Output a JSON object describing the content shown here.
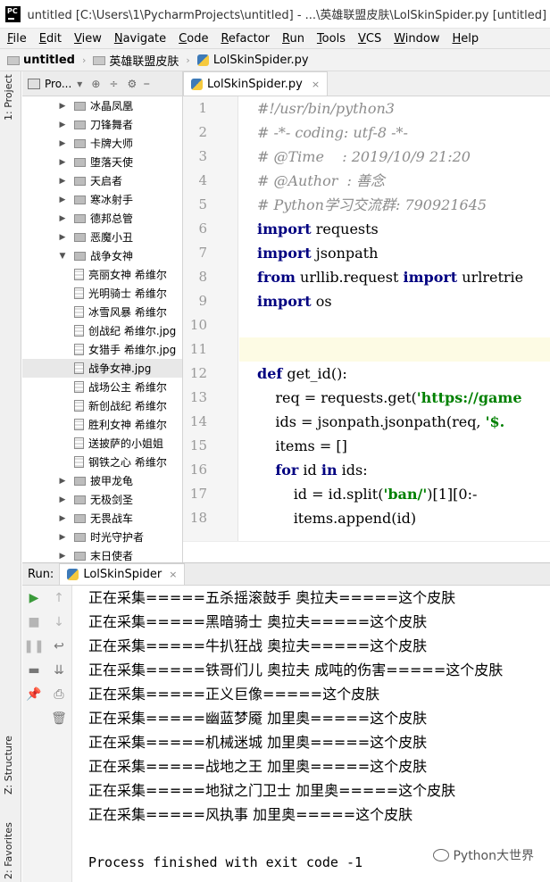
{
  "window": {
    "title": "untitled [C:\\Users\\1\\PycharmProjects\\untitled] - ...\\英雄联盟皮肤\\LolSkinSpider.py [untitled] - PyCharm",
    "logo_text": "PC"
  },
  "menu": [
    "File",
    "Edit",
    "View",
    "Navigate",
    "Code",
    "Refactor",
    "Run",
    "Tools",
    "VCS",
    "Window",
    "Help"
  ],
  "breadcrumb": {
    "project": "untitled",
    "folder": "英雄联盟皮肤",
    "file": "LolSkinSpider.py"
  },
  "project_panel": {
    "title": "Pro...",
    "side_tab": "1: Project",
    "items": [
      {
        "label": "冰晶凤凰",
        "type": "folder",
        "state": "collapsed"
      },
      {
        "label": "刀锋舞者",
        "type": "folder",
        "state": "collapsed"
      },
      {
        "label": "卡牌大师",
        "type": "folder",
        "state": "collapsed"
      },
      {
        "label": "堕落天使",
        "type": "folder",
        "state": "collapsed"
      },
      {
        "label": "天启者",
        "type": "folder",
        "state": "collapsed"
      },
      {
        "label": "寒冰射手",
        "type": "folder",
        "state": "collapsed"
      },
      {
        "label": "德邦总管",
        "type": "folder",
        "state": "collapsed"
      },
      {
        "label": "恶魔小丑",
        "type": "folder",
        "state": "collapsed"
      },
      {
        "label": "战争女神",
        "type": "folder",
        "state": "expanded"
      },
      {
        "label": "亮丽女神 希维尔",
        "type": "file"
      },
      {
        "label": "光明骑士 希维尔",
        "type": "file"
      },
      {
        "label": "冰雪风暴 希维尔",
        "type": "file"
      },
      {
        "label": "创战纪 希维尔.jpg",
        "type": "file"
      },
      {
        "label": "女猎手 希维尔.jpg",
        "type": "file"
      },
      {
        "label": "战争女神.jpg",
        "type": "file",
        "selected": true
      },
      {
        "label": "战场公主 希维尔",
        "type": "file"
      },
      {
        "label": "新创战纪 希维尔",
        "type": "file"
      },
      {
        "label": "胜利女神 希维尔",
        "type": "file"
      },
      {
        "label": "送披萨的小姐姐",
        "type": "file"
      },
      {
        "label": "钢铁之心 希维尔",
        "type": "file"
      },
      {
        "label": "披甲龙龟",
        "type": "folder",
        "state": "collapsed"
      },
      {
        "label": "无极剑圣",
        "type": "folder",
        "state": "collapsed"
      },
      {
        "label": "无畏战车",
        "type": "folder",
        "state": "collapsed"
      },
      {
        "label": "时光守护者",
        "type": "folder",
        "state": "collapsed"
      },
      {
        "label": "末日使者",
        "type": "folder",
        "state": "collapsed"
      }
    ]
  },
  "editor": {
    "tab": "LolSkinSpider.py",
    "line_numbers": [
      "1",
      "2",
      "3",
      "4",
      "5",
      "6",
      "7",
      "8",
      "9",
      "10",
      "11",
      "12",
      "13",
      "14",
      "15",
      "16",
      "17",
      "18"
    ],
    "lines": [
      [
        {
          "t": "#!/usr/bin/python3",
          "c": "cm"
        }
      ],
      [
        {
          "t": "# -*- coding: utf-8 -*-",
          "c": "cm"
        }
      ],
      [
        {
          "t": "# @Time    : 2019/10/9 21:20",
          "c": "cm"
        }
      ],
      [
        {
          "t": "# @Author  : 善念",
          "c": "cm"
        }
      ],
      [
        {
          "t": "# Python学习交流群: 790921645",
          "c": "cm"
        }
      ],
      [
        {
          "t": "import",
          "c": "kw"
        },
        {
          "t": " requests",
          "c": ""
        }
      ],
      [
        {
          "t": "import",
          "c": "kw"
        },
        {
          "t": " jsonpath",
          "c": ""
        }
      ],
      [
        {
          "t": "from",
          "c": "kw"
        },
        {
          "t": " urllib.request ",
          "c": ""
        },
        {
          "t": "import",
          "c": "kw"
        },
        {
          "t": " urlretrie",
          "c": ""
        }
      ],
      [
        {
          "t": "import",
          "c": "kw"
        },
        {
          "t": " os",
          "c": ""
        }
      ],
      [],
      [],
      [
        {
          "t": "def",
          "c": "kw"
        },
        {
          "t": " get_id():",
          "c": ""
        }
      ],
      [
        {
          "t": "    req = requests.get(",
          "c": ""
        },
        {
          "t": "'https://game",
          "c": "st"
        }
      ],
      [
        {
          "t": "    ids = jsonpath.jsonpath(req, ",
          "c": ""
        },
        {
          "t": "'$.",
          "c": "st"
        }
      ],
      [
        {
          "t": "    items = []",
          "c": ""
        }
      ],
      [
        {
          "t": "    ",
          "c": ""
        },
        {
          "t": "for",
          "c": "kw"
        },
        {
          "t": " id ",
          "c": ""
        },
        {
          "t": "in",
          "c": "kw"
        },
        {
          "t": " ids:",
          "c": ""
        }
      ],
      [
        {
          "t": "        id = id.split(",
          "c": ""
        },
        {
          "t": "'ban/'",
          "c": "st"
        },
        {
          "t": ")[1][0:-",
          "c": ""
        }
      ],
      [
        {
          "t": "        items.append(id)",
          "c": ""
        }
      ]
    ]
  },
  "run": {
    "label": "Run:",
    "tab": "LolSkinSpider",
    "output": [
      "正在采集=====五杀摇滚鼓手 奥拉夫=====这个皮肤",
      "正在采集=====黑暗骑士 奥拉夫=====这个皮肤",
      "正在采集=====牛扒狂战 奥拉夫=====这个皮肤",
      "正在采集=====铁哥们儿 奥拉夫 成吨的伤害=====这个皮肤",
      "正在采集=====正义巨像=====这个皮肤",
      "正在采集=====幽蓝梦魇 加里奥=====这个皮肤",
      "正在采集=====机械迷城 加里奥=====这个皮肤",
      "正在采集=====战地之王 加里奥=====这个皮肤",
      "正在采集=====地狱之门卫士 加里奥=====这个皮肤",
      "正在采集=====风执事 加里奥=====这个皮肤",
      "",
      "Process finished with exit code -1"
    ]
  },
  "side_tabs": {
    "structure": "Z: Structure",
    "favorites": "2: Favorites"
  },
  "watermark": "Python大世界"
}
